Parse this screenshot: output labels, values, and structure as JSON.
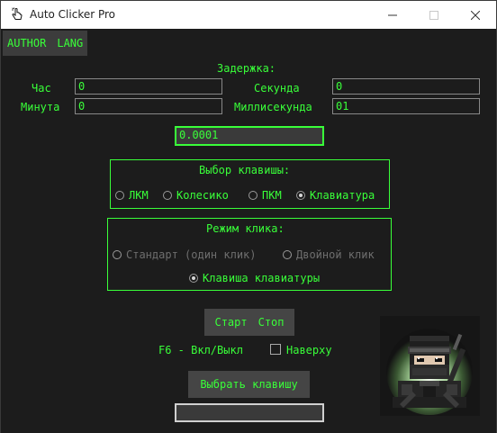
{
  "window": {
    "title": "Auto Clicker Pro"
  },
  "menu": {
    "author": "AUTHOR",
    "lang": "LANG"
  },
  "delay": {
    "heading": "Задержка:",
    "hours_label": "Час",
    "hours_value": "0",
    "seconds_label": "Секунда",
    "seconds_value": "0",
    "minutes_label": "Минута",
    "minutes_value": "0",
    "ms_label": "Миллисекунда",
    "ms_value": "01",
    "interval_value": "0.0001"
  },
  "key_select": {
    "heading": "Выбор клавишы:",
    "options": [
      "ЛКМ",
      "Колесико",
      "ПКМ",
      "Клавиатура"
    ],
    "selected": "Клавиатура"
  },
  "click_mode": {
    "heading": "Режим клика:",
    "standard": "Стандарт (один клик)",
    "double": "Двойной клик",
    "keyboard": "Клавиша клавиатуры",
    "selected": "Клавиша клавиатуры"
  },
  "controls": {
    "start": "Старт",
    "stop": "Стоп",
    "hotkey_info": "F6 - Вкл/Выкл",
    "on_top_label": "Наверху",
    "on_top_checked": false,
    "choose_key": "Выбрать клавишу",
    "key_value": ""
  },
  "colors": {
    "accent": "#39ff39",
    "background": "#1c1c1c",
    "button": "#454545"
  }
}
